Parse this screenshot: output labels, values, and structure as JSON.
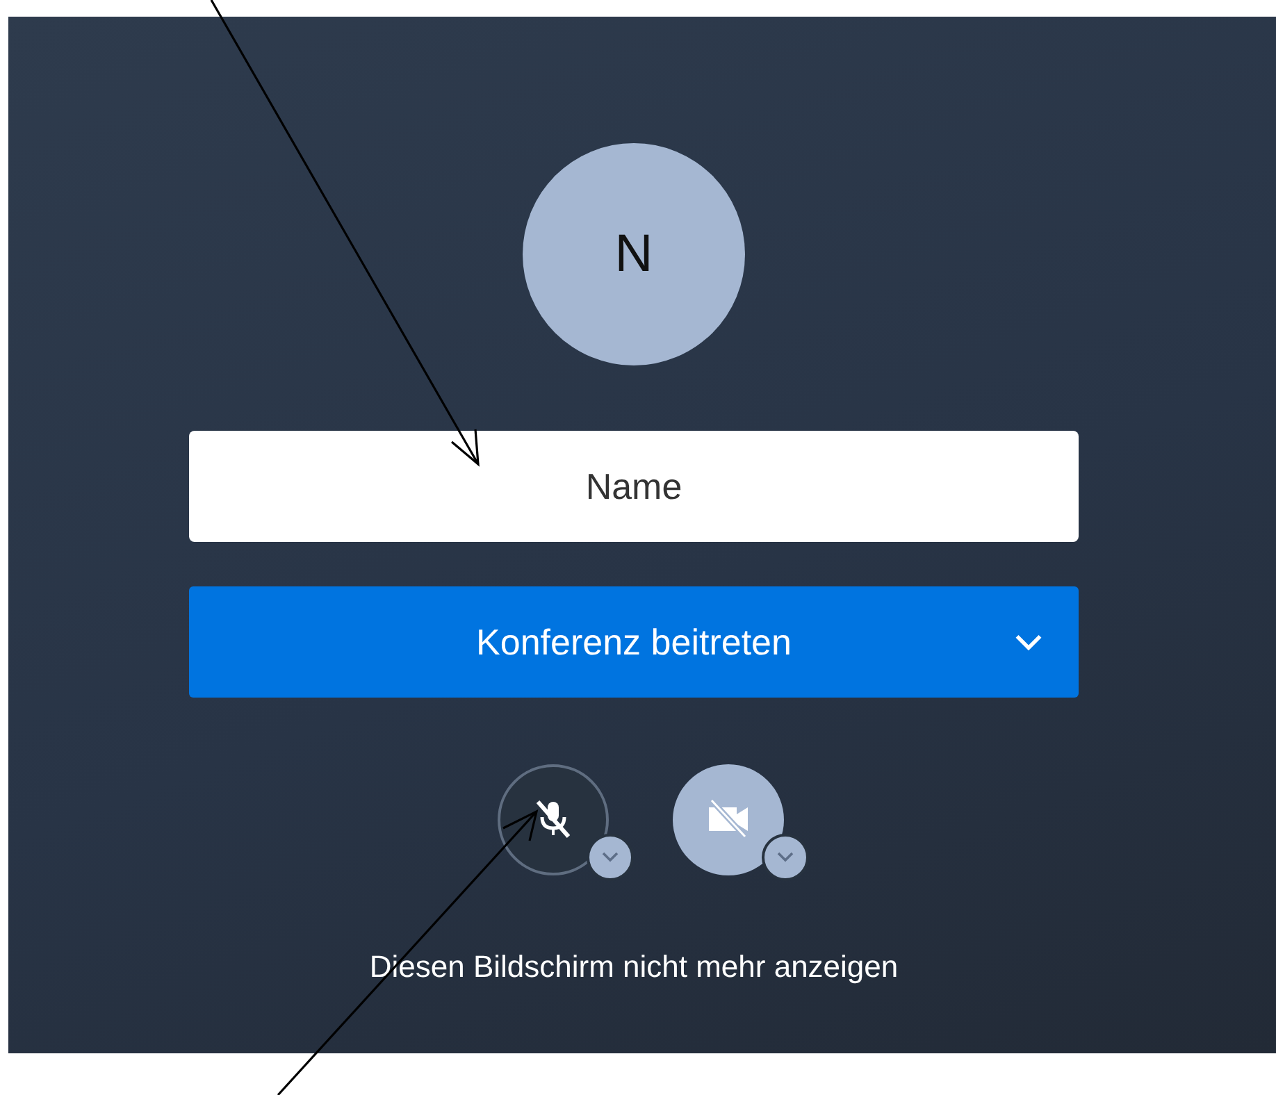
{
  "avatar": {
    "initial": "N"
  },
  "name_field": {
    "placeholder": "Name"
  },
  "join_button": {
    "label": "Konferenz beitreten",
    "has_menu": true
  },
  "media_buttons": [
    {
      "kind": "microphone",
      "muted": true
    },
    {
      "kind": "camera",
      "muted": true
    }
  ],
  "footer_link": "Diesen Bildschirm nicht mehr anzeigen"
}
